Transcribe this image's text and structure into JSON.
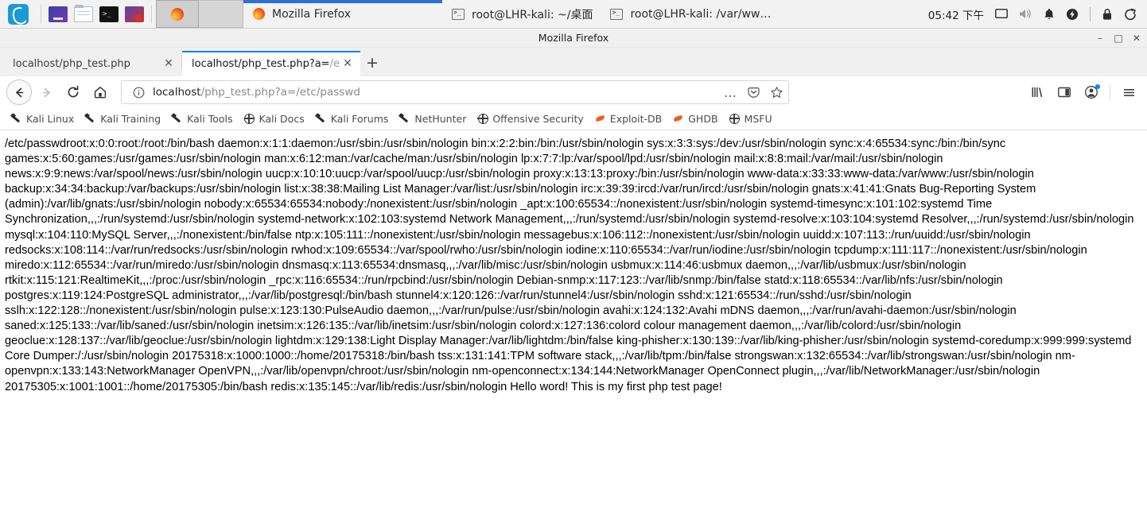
{
  "taskbar": {
    "menu_icon": "kali-dragon-logo",
    "launchers": [
      {
        "name": "terminal-emulator-launcher",
        "icon": "terminal-blue-icon"
      },
      {
        "name": "file-manager-launcher",
        "icon": "folder-icon"
      },
      {
        "name": "terminal-launcher",
        "icon": "terminal-black-icon"
      },
      {
        "name": "metasploit-launcher",
        "icon": "app-icon"
      }
    ],
    "active_task_icon": "firefox-icon",
    "windows": [
      {
        "icon": "firefox-icon",
        "label": "Mozilla Firefox"
      },
      {
        "icon": "terminal-icon",
        "label": "root@LHR-kali: ~/桌面"
      },
      {
        "icon": "terminal-icon",
        "label": "root@LHR-kali: /var/ww…"
      }
    ],
    "clock": "05:42 下午",
    "tray": [
      {
        "name": "display-icon",
        "glyph": "⬜"
      },
      {
        "name": "volume-icon",
        "glyph": "🔊"
      },
      {
        "name": "notification-bell-icon",
        "glyph": "🔔"
      },
      {
        "name": "power-status-icon",
        "glyph": "⚡"
      },
      {
        "name": "lock-screen-icon",
        "glyph": "🔒"
      },
      {
        "name": "logout-icon",
        "glyph": "↪"
      }
    ]
  },
  "window": {
    "title": "Mozilla Firefox",
    "controls": {
      "minimize": "–",
      "maximize": "□",
      "close": "✕"
    }
  },
  "tabs": [
    {
      "label": "localhost/php_test.php",
      "label_dim": "",
      "active": false,
      "close": "✕"
    },
    {
      "label": "localhost/php_test.php?a=",
      "label_dim": "/e",
      "active": true,
      "close": "✕"
    }
  ],
  "newtab": {
    "label": "+",
    "tooltip": "New Tab"
  },
  "nav": {
    "back": "←",
    "forward": "→",
    "reload": "↻",
    "home": "⌂"
  },
  "urlbar": {
    "identity_icon": "info-circle-icon",
    "host": "localhost",
    "path": "/php_test.php?a=/etc/passwd",
    "full_url": "localhost/php_test.php?a=/etc/passwd",
    "page_actions": "…",
    "pocket": "save-to-pocket-icon",
    "bookmark_star": "☆"
  },
  "toolbar_right": [
    {
      "name": "library-icon",
      "glyph": "‖∖"
    },
    {
      "name": "sidebar-icon",
      "glyph": "▥"
    },
    {
      "name": "account-icon",
      "glyph": "●",
      "badge": true
    },
    {
      "name": "app-menu-icon",
      "glyph": "☰"
    }
  ],
  "bookmarks": [
    {
      "label": "Kali Linux",
      "icon": "wrench"
    },
    {
      "label": "Kali Training",
      "icon": "wrench"
    },
    {
      "label": "Kali Tools",
      "icon": "wrench"
    },
    {
      "label": "Kali Docs",
      "icon": "globe"
    },
    {
      "label": "Kali Forums",
      "icon": "wrench"
    },
    {
      "label": "NetHunter",
      "icon": "wrench"
    },
    {
      "label": "Offensive Security",
      "icon": "globe"
    },
    {
      "label": "Exploit-DB",
      "icon": "drop"
    },
    {
      "label": "GHDB",
      "icon": "drop"
    },
    {
      "label": "MSFU",
      "icon": "globe"
    }
  ],
  "content": {
    "body_text": "/etc/passwdroot:x:0:0:root:/root:/bin/bash daemon:x:1:1:daemon:/usr/sbin:/usr/sbin/nologin bin:x:2:2:bin:/bin:/usr/sbin/nologin sys:x:3:3:sys:/dev:/usr/sbin/nologin sync:x:4:65534:sync:/bin:/bin/sync games:x:5:60:games:/usr/games:/usr/sbin/nologin man:x:6:12:man:/var/cache/man:/usr/sbin/nologin lp:x:7:7:lp:/var/spool/lpd:/usr/sbin/nologin mail:x:8:8:mail:/var/mail:/usr/sbin/nologin news:x:9:9:news:/var/spool/news:/usr/sbin/nologin uucp:x:10:10:uucp:/var/spool/uucp:/usr/sbin/nologin proxy:x:13:13:proxy:/bin:/usr/sbin/nologin www-data:x:33:33:www-data:/var/www:/usr/sbin/nologin backup:x:34:34:backup:/var/backups:/usr/sbin/nologin list:x:38:38:Mailing List Manager:/var/list:/usr/sbin/nologin irc:x:39:39:ircd:/var/run/ircd:/usr/sbin/nologin gnats:x:41:41:Gnats Bug-Reporting System (admin):/var/lib/gnats:/usr/sbin/nologin nobody:x:65534:65534:nobody:/nonexistent:/usr/sbin/nologin _apt:x:100:65534::/nonexistent:/usr/sbin/nologin systemd-timesync:x:101:102:systemd Time Synchronization,,,:/run/systemd:/usr/sbin/nologin systemd-network:x:102:103:systemd Network Management,,,:/run/systemd:/usr/sbin/nologin systemd-resolve:x:103:104:systemd Resolver,,,:/run/systemd:/usr/sbin/nologin mysql:x:104:110:MySQL Server,,,:/nonexistent:/bin/false ntp:x:105:111::/nonexistent:/usr/sbin/nologin messagebus:x:106:112::/nonexistent:/usr/sbin/nologin uuidd:x:107:113::/run/uuidd:/usr/sbin/nologin redsocks:x:108:114::/var/run/redsocks:/usr/sbin/nologin rwhod:x:109:65534::/var/spool/rwho:/usr/sbin/nologin iodine:x:110:65534::/var/run/iodine:/usr/sbin/nologin tcpdump:x:111:117::/nonexistent:/usr/sbin/nologin miredo:x:112:65534::/var/run/miredo:/usr/sbin/nologin dnsmasq:x:113:65534:dnsmasq,,,:/var/lib/misc:/usr/sbin/nologin usbmux:x:114:46:usbmux daemon,,,:/var/lib/usbmux:/usr/sbin/nologin rtkit:x:115:121:RealtimeKit,,,:/proc:/usr/sbin/nologin _rpc:x:116:65534::/run/rpcbind:/usr/sbin/nologin Debian-snmp:x:117:123::/var/lib/snmp:/bin/false statd:x:118:65534::/var/lib/nfs:/usr/sbin/nologin postgres:x:119:124:PostgreSQL administrator,,,:/var/lib/postgresql:/bin/bash stunnel4:x:120:126::/var/run/stunnel4:/usr/sbin/nologin sshd:x:121:65534::/run/sshd:/usr/sbin/nologin sslh:x:122:128::/nonexistent:/usr/sbin/nologin pulse:x:123:130:PulseAudio daemon,,,:/var/run/pulse:/usr/sbin/nologin avahi:x:124:132:Avahi mDNS daemon,,,:/var/run/avahi-daemon:/usr/sbin/nologin saned:x:125:133::/var/lib/saned:/usr/sbin/nologin inetsim:x:126:135::/var/lib/inetsim:/usr/sbin/nologin colord:x:127:136:colord colour management daemon,,,:/var/lib/colord:/usr/sbin/nologin geoclue:x:128:137::/var/lib/geoclue:/usr/sbin/nologin lightdm:x:129:138:Light Display Manager:/var/lib/lightdm:/bin/false king-phisher:x:130:139::/var/lib/king-phisher:/usr/sbin/nologin systemd-coredump:x:999:999:systemd Core Dumper:/:/usr/sbin/nologin 20175318:x:1000:1000::/home/20175318:/bin/bash tss:x:131:141:TPM software stack,,,:/var/lib/tpm:/bin/false strongswan:x:132:65534::/var/lib/strongswan:/usr/sbin/nologin nm-openvpn:x:133:143:NetworkManager OpenVPN,,,:/var/lib/openvpn/chroot:/usr/sbin/nologin nm-openconnect:x:134:144:NetworkManager OpenConnect plugin,,,:/var/lib/NetworkManager:/usr/sbin/nologin 20175305:x:1001:1001::/home/20175305:/bin/bash redis:x:135:145::/var/lib/redis:/usr/sbin/nologin Hello word! This is my first php test page!"
  },
  "colors": {
    "accent": "#0a84ff",
    "taskbar_bg": "#f2f2f2",
    "kali_blue": "#1b9ad6",
    "exploitdb_orange": "#e8621c"
  }
}
